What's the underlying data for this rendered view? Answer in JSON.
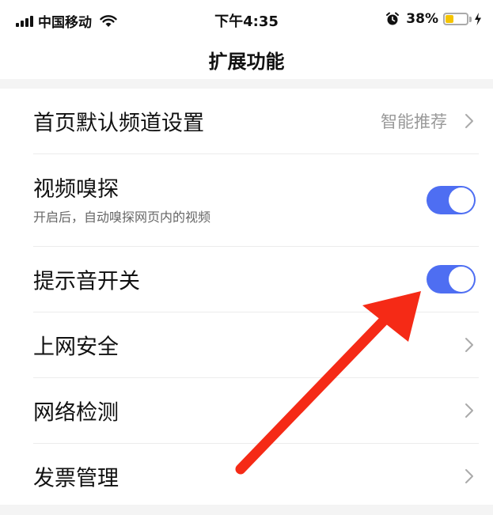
{
  "status_bar": {
    "carrier": "中国移动",
    "time": "下午4:35",
    "battery_text": "38%",
    "battery_level": 0.38,
    "battery_color": "#f5c400"
  },
  "header": {
    "title": "扩展功能"
  },
  "settings": [
    {
      "title": "首页默认频道设置",
      "value": "智能推荐",
      "control": "chevron"
    },
    {
      "title": "视频嗅探",
      "subtitle": "开启后，自动嗅探网页内的视频",
      "control": "toggle",
      "on": true
    },
    {
      "title": "提示音开关",
      "control": "toggle",
      "on": true
    },
    {
      "title": "上网安全",
      "control": "chevron"
    },
    {
      "title": "网络检测",
      "control": "chevron"
    },
    {
      "title": "发票管理",
      "control": "chevron"
    }
  ],
  "colors": {
    "toggle_on": "#4e6ef2",
    "annotation_arrow": "#f52a16"
  },
  "icons": {
    "signal": "signal-bars-icon",
    "wifi": "wifi-icon",
    "alarm": "alarm-clock-icon",
    "battery": "battery-icon",
    "charging": "lightning-bolt-icon",
    "chevron": "chevron-right-icon"
  }
}
